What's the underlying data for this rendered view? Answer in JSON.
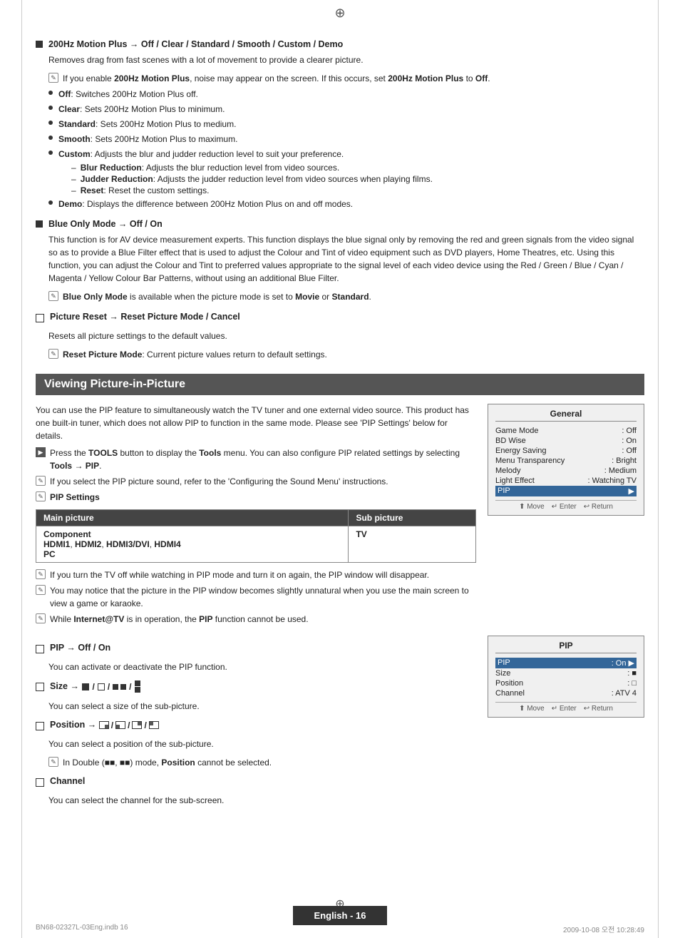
{
  "page": {
    "top_icon": "⊕",
    "bottom_icon": "⊕",
    "footer_text": "English - 16",
    "meta_left": "BN68-02327L-03Eng.indb   16",
    "meta_right": "2009-10-08   오전 10:28:49"
  },
  "sections": [
    {
      "id": "200hz",
      "title": "200Hz Motion Plus → Off / Clear / Standard / Smooth / Custom / Demo",
      "body": "Removes drag from fast scenes with a lot of movement to provide a clearer picture.",
      "note": "If you enable 200Hz Motion Plus, noise may appear on the screen. If this occurs, set 200Hz Motion Plus to Off.",
      "bullets": [
        {
          "label": "Off",
          "text": ": Switches 200Hz Motion Plus off."
        },
        {
          "label": "Clear",
          "text": ": Sets 200Hz Motion Plus to minimum."
        },
        {
          "label": "Standard",
          "text": ": Sets 200Hz Motion Plus to medium."
        },
        {
          "label": "Smooth",
          "text": ": Sets 200Hz Motion Plus to maximum."
        },
        {
          "label": "Custom",
          "text": ": Adjusts the blur and judder reduction level to suit your preference."
        },
        {
          "label": "Demo",
          "text": ": Displays the difference between 200Hz Motion Plus on and off modes."
        }
      ],
      "sub_bullets": [
        {
          "label": "Blur Reduction",
          "text": ": Adjusts the blur reduction level from video sources."
        },
        {
          "label": "Judder Reduction",
          "text": ": Adjusts the judder reduction level from video sources when playing films."
        },
        {
          "label": "Reset",
          "text": ": Reset the custom settings."
        }
      ]
    },
    {
      "id": "blue_only",
      "title": "Blue Only Mode → Off / On",
      "body": "This function is for AV device measurement experts. This function displays the blue signal only by removing the red and green signals from the video signal so as to provide a Blue Filter effect that is used to adjust the Colour and Tint of video equipment such as DVD players, Home Theatres, etc. Using this function, you can adjust the Colour and Tint to preferred values appropriate to the signal level of each video device using the Red / Green / Blue / Cyan / Magenta / Yellow Colour Bar Patterns, without using an additional Blue Filter.",
      "note": "Blue Only Mode is available when the picture mode is set to Movie or Standard."
    },
    {
      "id": "picture_reset",
      "title": "Picture Reset → Reset Picture Mode / Cancel",
      "body": "Resets all picture settings to the default values.",
      "note": "Reset Picture Mode: Current picture values return to default settings."
    }
  ],
  "pip_section": {
    "heading": "Viewing Picture-in-Picture",
    "intro": "You can use the PIP feature to simultaneously watch the TV tuner and one external video source. This product has one built-in tuner, which does not allow PIP to function in the same mode. Please see 'PIP Settings' below for details.",
    "note1": "Press the TOOLS button to display the Tools menu. You can also configure PIP related settings by selecting Tools → PIP.",
    "note2": "If you select the PIP picture sound, refer to the 'Configuring the Sound Menu' instructions.",
    "pip_settings_label": "PIP Settings",
    "table": {
      "col1": "Main picture",
      "col2": "Sub picture",
      "rows": [
        {
          "main": "Component\nHDMI1, HDMI2, HDMI3/DVI, HDMI4\nPC",
          "sub": "TV"
        }
      ]
    },
    "notes_after": [
      "If you turn the TV off while watching in PIP mode and turn it on again, the PIP window will disappear.",
      "You may notice that the picture in the PIP window becomes slightly unnatural when you use the main screen to view a game or karaoke.",
      "While Internet@TV is in operation, the PIP function cannot be used."
    ]
  },
  "pip_subsections": [
    {
      "id": "pip_onoff",
      "title": "PIP → Off / On",
      "body": "You can activate or deactivate the PIP function."
    },
    {
      "id": "pip_size",
      "title": "Size",
      "body": "You can select a size of the sub-picture."
    },
    {
      "id": "pip_position",
      "title": "Position",
      "body": "You can select a position of the sub-picture.",
      "note": "In Double (■■, ■■) mode, Position cannot be selected."
    },
    {
      "id": "pip_channel",
      "title": "Channel",
      "body": "You can select the channel for the sub-screen."
    }
  ],
  "general_box": {
    "title": "General",
    "rows": [
      {
        "label": "Game Mode",
        "value": ": Off"
      },
      {
        "label": "BD Wise",
        "value": ": On"
      },
      {
        "label": "Energy Saving",
        "value": ": Off"
      },
      {
        "label": "Menu Transparency",
        "value": ": Bright"
      },
      {
        "label": "Melody",
        "value": ": Medium"
      },
      {
        "label": "Light Effect",
        "value": ": Watching TV"
      },
      {
        "label": "PIP",
        "value": "▶",
        "highlighted": true
      }
    ],
    "footer": [
      "⬆ Move",
      "↵ Enter",
      "↩ Return"
    ]
  },
  "pip_box": {
    "title": "PIP",
    "rows": [
      {
        "label": "PIP",
        "value": ": On ▶",
        "highlighted": true
      },
      {
        "label": "Size",
        "value": ": ■"
      },
      {
        "label": "Position",
        "value": ": □"
      },
      {
        "label": "Channel",
        "value": ": ATV 4"
      }
    ],
    "footer": [
      "⬆ Move",
      "↵ Enter",
      "↩ Return"
    ]
  }
}
